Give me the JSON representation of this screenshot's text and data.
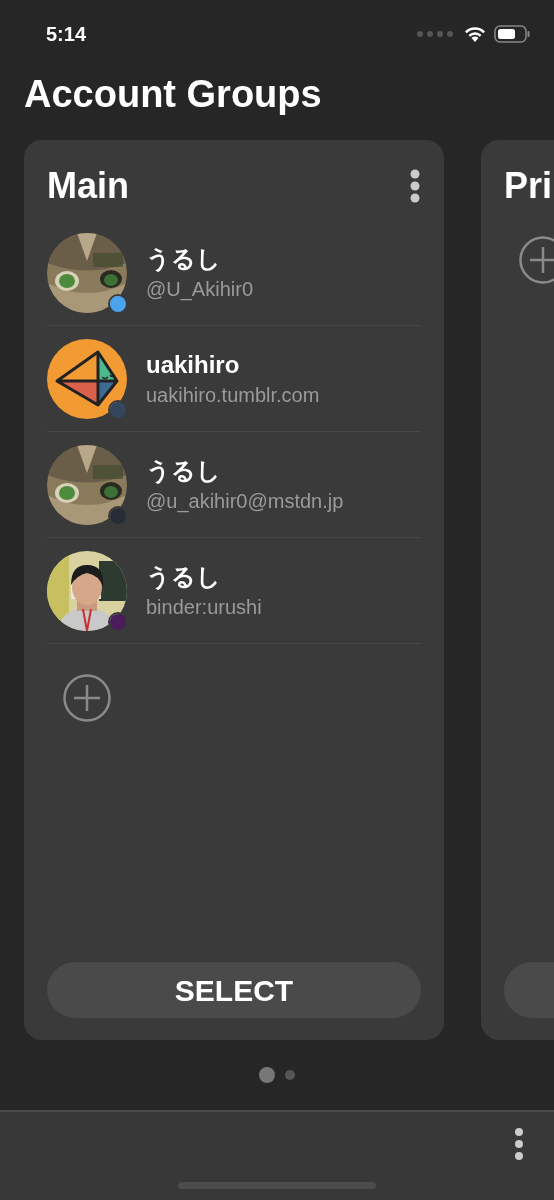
{
  "status_bar": {
    "time": "5:14"
  },
  "title": "Account Groups",
  "groups": [
    {
      "title": "Main",
      "accounts": [
        {
          "name": "うるし",
          "handle": "@U_Akihir0",
          "color": "#4aa3ec"
        },
        {
          "name": "uakihiro",
          "handle": "uakihiro.tumblr.com",
          "color": "#34465d",
          "avatar": {
            "kind": "logo"
          }
        },
        {
          "name": "うるし",
          "handle": "@u_akihir0@mstdn.jp",
          "color": "#282c37"
        },
        {
          "name": "うるし",
          "handle": "binder:urushi",
          "color": "#4a1d5a"
        }
      ],
      "button": "SELECT"
    },
    {
      "title": "Pri"
    }
  ],
  "page_dots": [
    {
      "selected": true
    },
    {
      "selected": false
    }
  ]
}
